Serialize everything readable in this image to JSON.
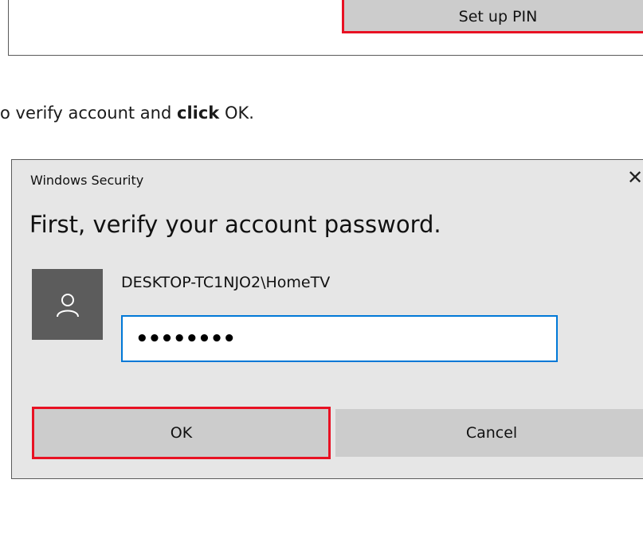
{
  "top_panel": {
    "setup_pin_label": "Set up PIN"
  },
  "instruction": {
    "prefix": "o verify account and ",
    "bold": "click",
    "suffix": " OK."
  },
  "dialog": {
    "title": "Windows Security",
    "heading": "First, verify your account password.",
    "account_name": "DESKTOP-TC1NJO2\\HomeTV",
    "password_masked": "••••••••",
    "ok_label": "OK",
    "cancel_label": "Cancel",
    "close_glyph": "✕",
    "icons": {
      "avatar": "person-icon",
      "close": "close-icon"
    }
  },
  "colors": {
    "highlight": "#e81123",
    "focus_border": "#0078d7",
    "dialog_bg": "#e6e6e6",
    "button_bg": "#cccccc",
    "avatar_bg": "#5c5c5c"
  }
}
